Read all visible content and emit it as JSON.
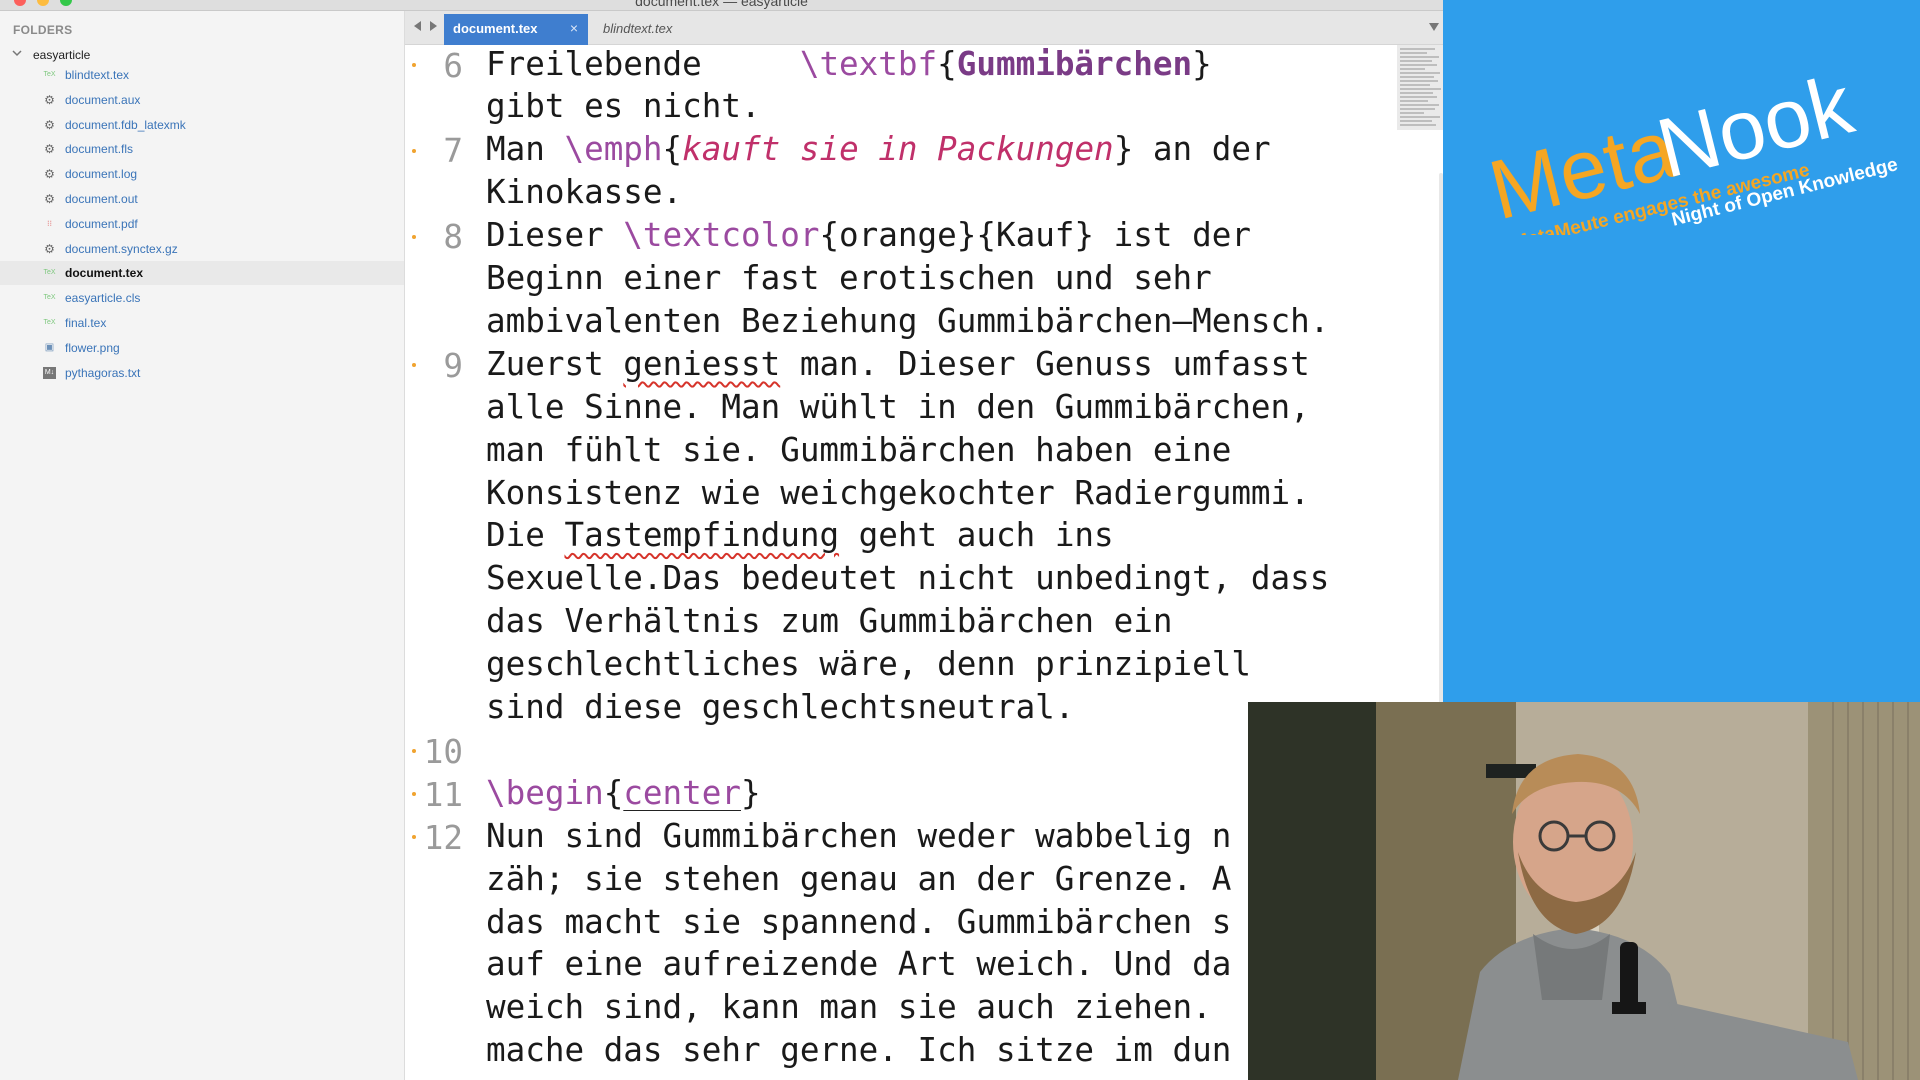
{
  "window": {
    "title": "document.tex — easyarticle",
    "colors": {
      "close": "#fc605c",
      "minimize": "#fdbc40",
      "maximize": "#34c84a"
    }
  },
  "sidebar": {
    "header": "FOLDERS",
    "root_folder": "easyarticle",
    "files": [
      {
        "name": "blindtext.tex",
        "icon": "tex-file-icon",
        "selected": false
      },
      {
        "name": "document.aux",
        "icon": "gear-icon",
        "selected": false
      },
      {
        "name": "document.fdb_latexmk",
        "icon": "gear-icon",
        "selected": false
      },
      {
        "name": "document.fls",
        "icon": "gear-icon",
        "selected": false
      },
      {
        "name": "document.log",
        "icon": "gear-icon",
        "selected": false
      },
      {
        "name": "document.out",
        "icon": "gear-icon",
        "selected": false
      },
      {
        "name": "document.pdf",
        "icon": "pdf-file-icon",
        "selected": false
      },
      {
        "name": "document.synctex.gz",
        "icon": "gear-icon",
        "selected": false
      },
      {
        "name": "document.tex",
        "icon": "tex-file-icon",
        "selected": true
      },
      {
        "name": "easyarticle.cls",
        "icon": "tex-file-icon",
        "selected": false
      },
      {
        "name": "final.tex",
        "icon": "tex-file-icon",
        "selected": false
      },
      {
        "name": "flower.png",
        "icon": "image-file-icon",
        "selected": false
      },
      {
        "name": "pythagoras.txt",
        "icon": "markdown-file-icon",
        "selected": false
      }
    ]
  },
  "tabs": [
    {
      "label": "document.tex",
      "active": true,
      "close": "×"
    },
    {
      "label": "blindtext.tex",
      "active": false
    }
  ],
  "editor": {
    "lines": [
      {
        "number": "6",
        "rows": [
          "Freilebende     \\textbf{Gummibärchen}",
          "gibt es nicht."
        ]
      },
      {
        "number": "7",
        "rows": [
          "Man \\emph{kauft sie in Packungen} an der",
          "Kinokasse."
        ]
      },
      {
        "number": "8",
        "rows": [
          "Dieser \\textcolor{orange}{Kauf} ist der",
          "Beginn einer fast erotischen und sehr",
          "ambivalenten Beziehung Gummibärchen–Mensch."
        ]
      },
      {
        "number": "9",
        "rows": [
          "Zuerst geniesst man. Dieser Genuss umfasst",
          "alle Sinne. Man wühlt in den Gummibärchen,",
          "man fühlt sie. Gummibärchen haben eine",
          "Konsistenz wie weichgekochter Radiergummi.",
          "Die Tastempfindung geht auch ins",
          "Sexuelle.Das bedeutet nicht unbedingt, dass",
          "das Verhältnis zum Gummibärchen ein",
          "geschlechtliches wäre, denn prinzipiell",
          "sind diese geschlechtsneutral."
        ]
      },
      {
        "number": "10",
        "rows": [
          ""
        ]
      },
      {
        "number": "11",
        "rows": [
          "\\begin{center}"
        ]
      },
      {
        "number": "12",
        "rows": [
          "Nun sind Gummibärchen weder wabbelig n",
          "zäh; sie stehen genau an der Grenze. A",
          "das macht sie spannend. Gummibärchen s",
          "auf eine aufreizende Art weich. Und da",
          "weich sind, kann man sie auch ziehen.",
          "mache das sehr gerne. Ich sitze im dun"
        ]
      }
    ]
  },
  "brand": {
    "name_part1": "Meta",
    "name_part2": "Nook",
    "tagline_orange": "MetaMeute engages the awesome",
    "tagline_white": "Night of Open Knowledge",
    "background": "#2f9eeb",
    "accent": "#f5a623"
  }
}
